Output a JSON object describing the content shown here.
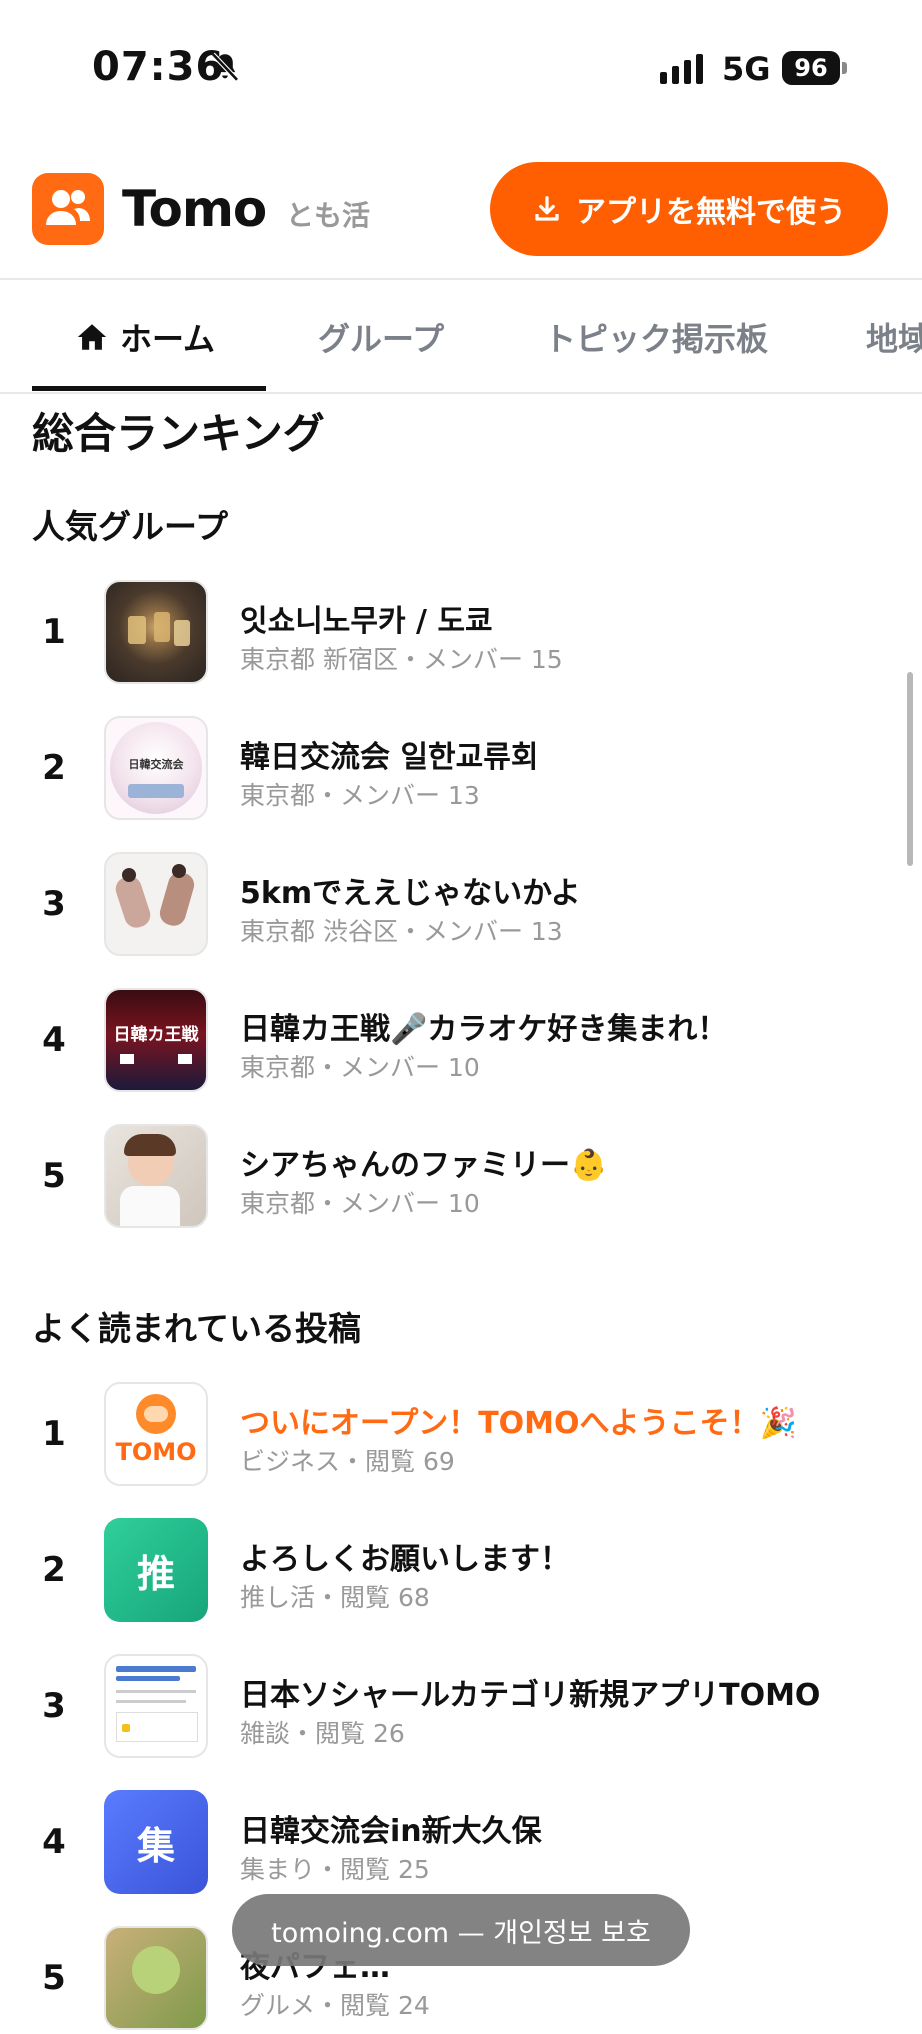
{
  "status_bar": {
    "time": "07:36",
    "network": "5G",
    "battery": "96"
  },
  "header": {
    "brand": "Tomo",
    "tagline": "とも活",
    "cta_label": "アプリを無料で使う",
    "accent_color": "#ff5f00"
  },
  "tabs": [
    {
      "label": "ホーム",
      "icon": "home-icon",
      "active": true
    },
    {
      "label": "グループ"
    },
    {
      "label": "トピック掲示板"
    },
    {
      "label": "地域"
    }
  ],
  "ranking": {
    "title": "総合ランキング",
    "popular_groups": {
      "title": "人気グループ",
      "items": [
        {
          "rank": "1",
          "name": "잇쇼니노무카 / 도쿄",
          "meta": "東京都 新宿区・メンバー 15"
        },
        {
          "rank": "2",
          "name": "韓日交流会 일한교류회",
          "meta": "東京都・メンバー 13",
          "thumb_text": "日韓交流会"
        },
        {
          "rank": "3",
          "name": "5kmでええじゃないかよ",
          "meta": "東京都 渋谷区・メンバー 13"
        },
        {
          "rank": "4",
          "name": "日韓カ王戦🎤カラオケ好き集まれ！",
          "meta": "東京都・メンバー 10",
          "thumb_text": "日韓カ王戦"
        },
        {
          "rank": "5",
          "name": "シアちゃんのファミリー👶",
          "meta": "東京都・メンバー 10"
        }
      ]
    },
    "popular_posts": {
      "title": "よく読まれている投稿",
      "items": [
        {
          "rank": "1",
          "name": "ついにオープン！TOMOへようこそ！🎉",
          "meta": "ビジネス・閲覧 69",
          "thumb_text": "TOMO"
        },
        {
          "rank": "2",
          "name": "よろしくお願いします！",
          "meta": "推し活・閲覧 68",
          "thumb_text": "推"
        },
        {
          "rank": "3",
          "name": "日本ソシャールカテゴリ新規アプリTOMO",
          "meta": "雑談・閲覧 26"
        },
        {
          "rank": "4",
          "name": "日韓交流会in新大久保",
          "meta": "集まり・閲覧 25",
          "thumb_text": "集"
        },
        {
          "rank": "5",
          "name": "夜パフェ…",
          "meta": "グルメ・閲覧 24"
        }
      ]
    }
  },
  "toast": "tomoing.com — 개인정보 보호"
}
